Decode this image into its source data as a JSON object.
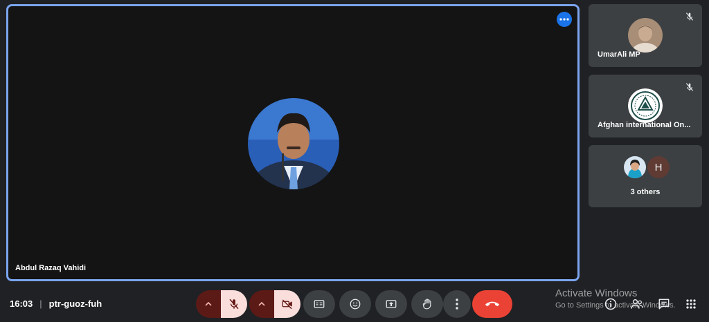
{
  "main_tile": {
    "name": "Abdul Razaq Vahidi",
    "more_options_icon": "more-horiz-icon",
    "active_speaker_border": "#7aa5ee"
  },
  "side_tiles": [
    {
      "name": "UmarAli MP",
      "muted": true
    },
    {
      "name": "Afghan international On...",
      "muted": true
    },
    {
      "name": "3 others",
      "avatars": [
        "photo",
        "H"
      ]
    }
  ],
  "meeting": {
    "time": "16:03",
    "separator": "|",
    "code": "ptr-guoz-fuh"
  },
  "controls": {
    "mic": {
      "icon": "mic-off-icon",
      "state": "off"
    },
    "camera": {
      "icon": "videocam-off-icon",
      "state": "off"
    },
    "captions": {
      "icon": "closed-caption-icon"
    },
    "reactions": {
      "icon": "emoji-icon"
    },
    "present": {
      "icon": "present-screen-icon"
    },
    "raise_hand": {
      "icon": "hand-icon"
    },
    "more": {
      "icon": "more-vert-icon"
    },
    "end_call": {
      "icon": "call-end-icon",
      "color": "#ea4335"
    }
  },
  "watermark": {
    "line1": "Activate Windows",
    "line2": "Go to Settings to activate Windows."
  },
  "right_panel_icons": [
    "info-icon",
    "people-icon",
    "chat-icon",
    "activities-icon"
  ]
}
